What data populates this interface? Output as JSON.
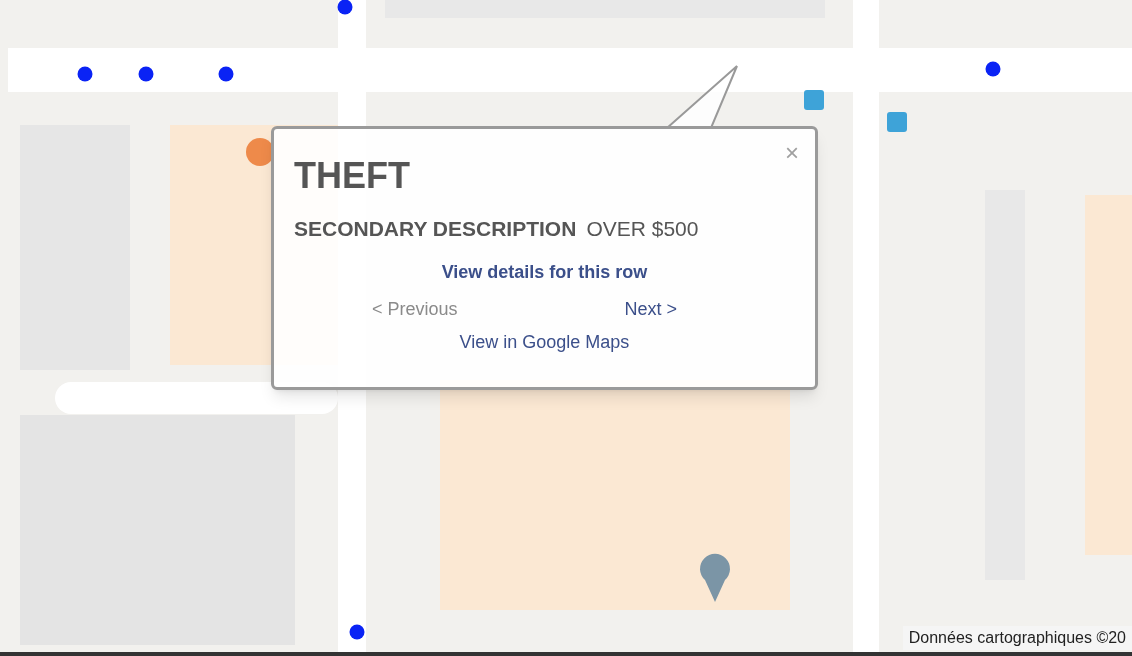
{
  "info_window": {
    "title": "THEFT",
    "field_label": "SECONDARY DESCRIPTION",
    "field_value": "OVER $500",
    "details_link": "View details for this row",
    "previous": {
      "label": "< Previous",
      "disabled": true
    },
    "next": {
      "label": "Next >",
      "disabled": false
    },
    "maps_link": "View in Google Maps",
    "close": "×"
  },
  "attribution": "Données cartographiques ©20"
}
